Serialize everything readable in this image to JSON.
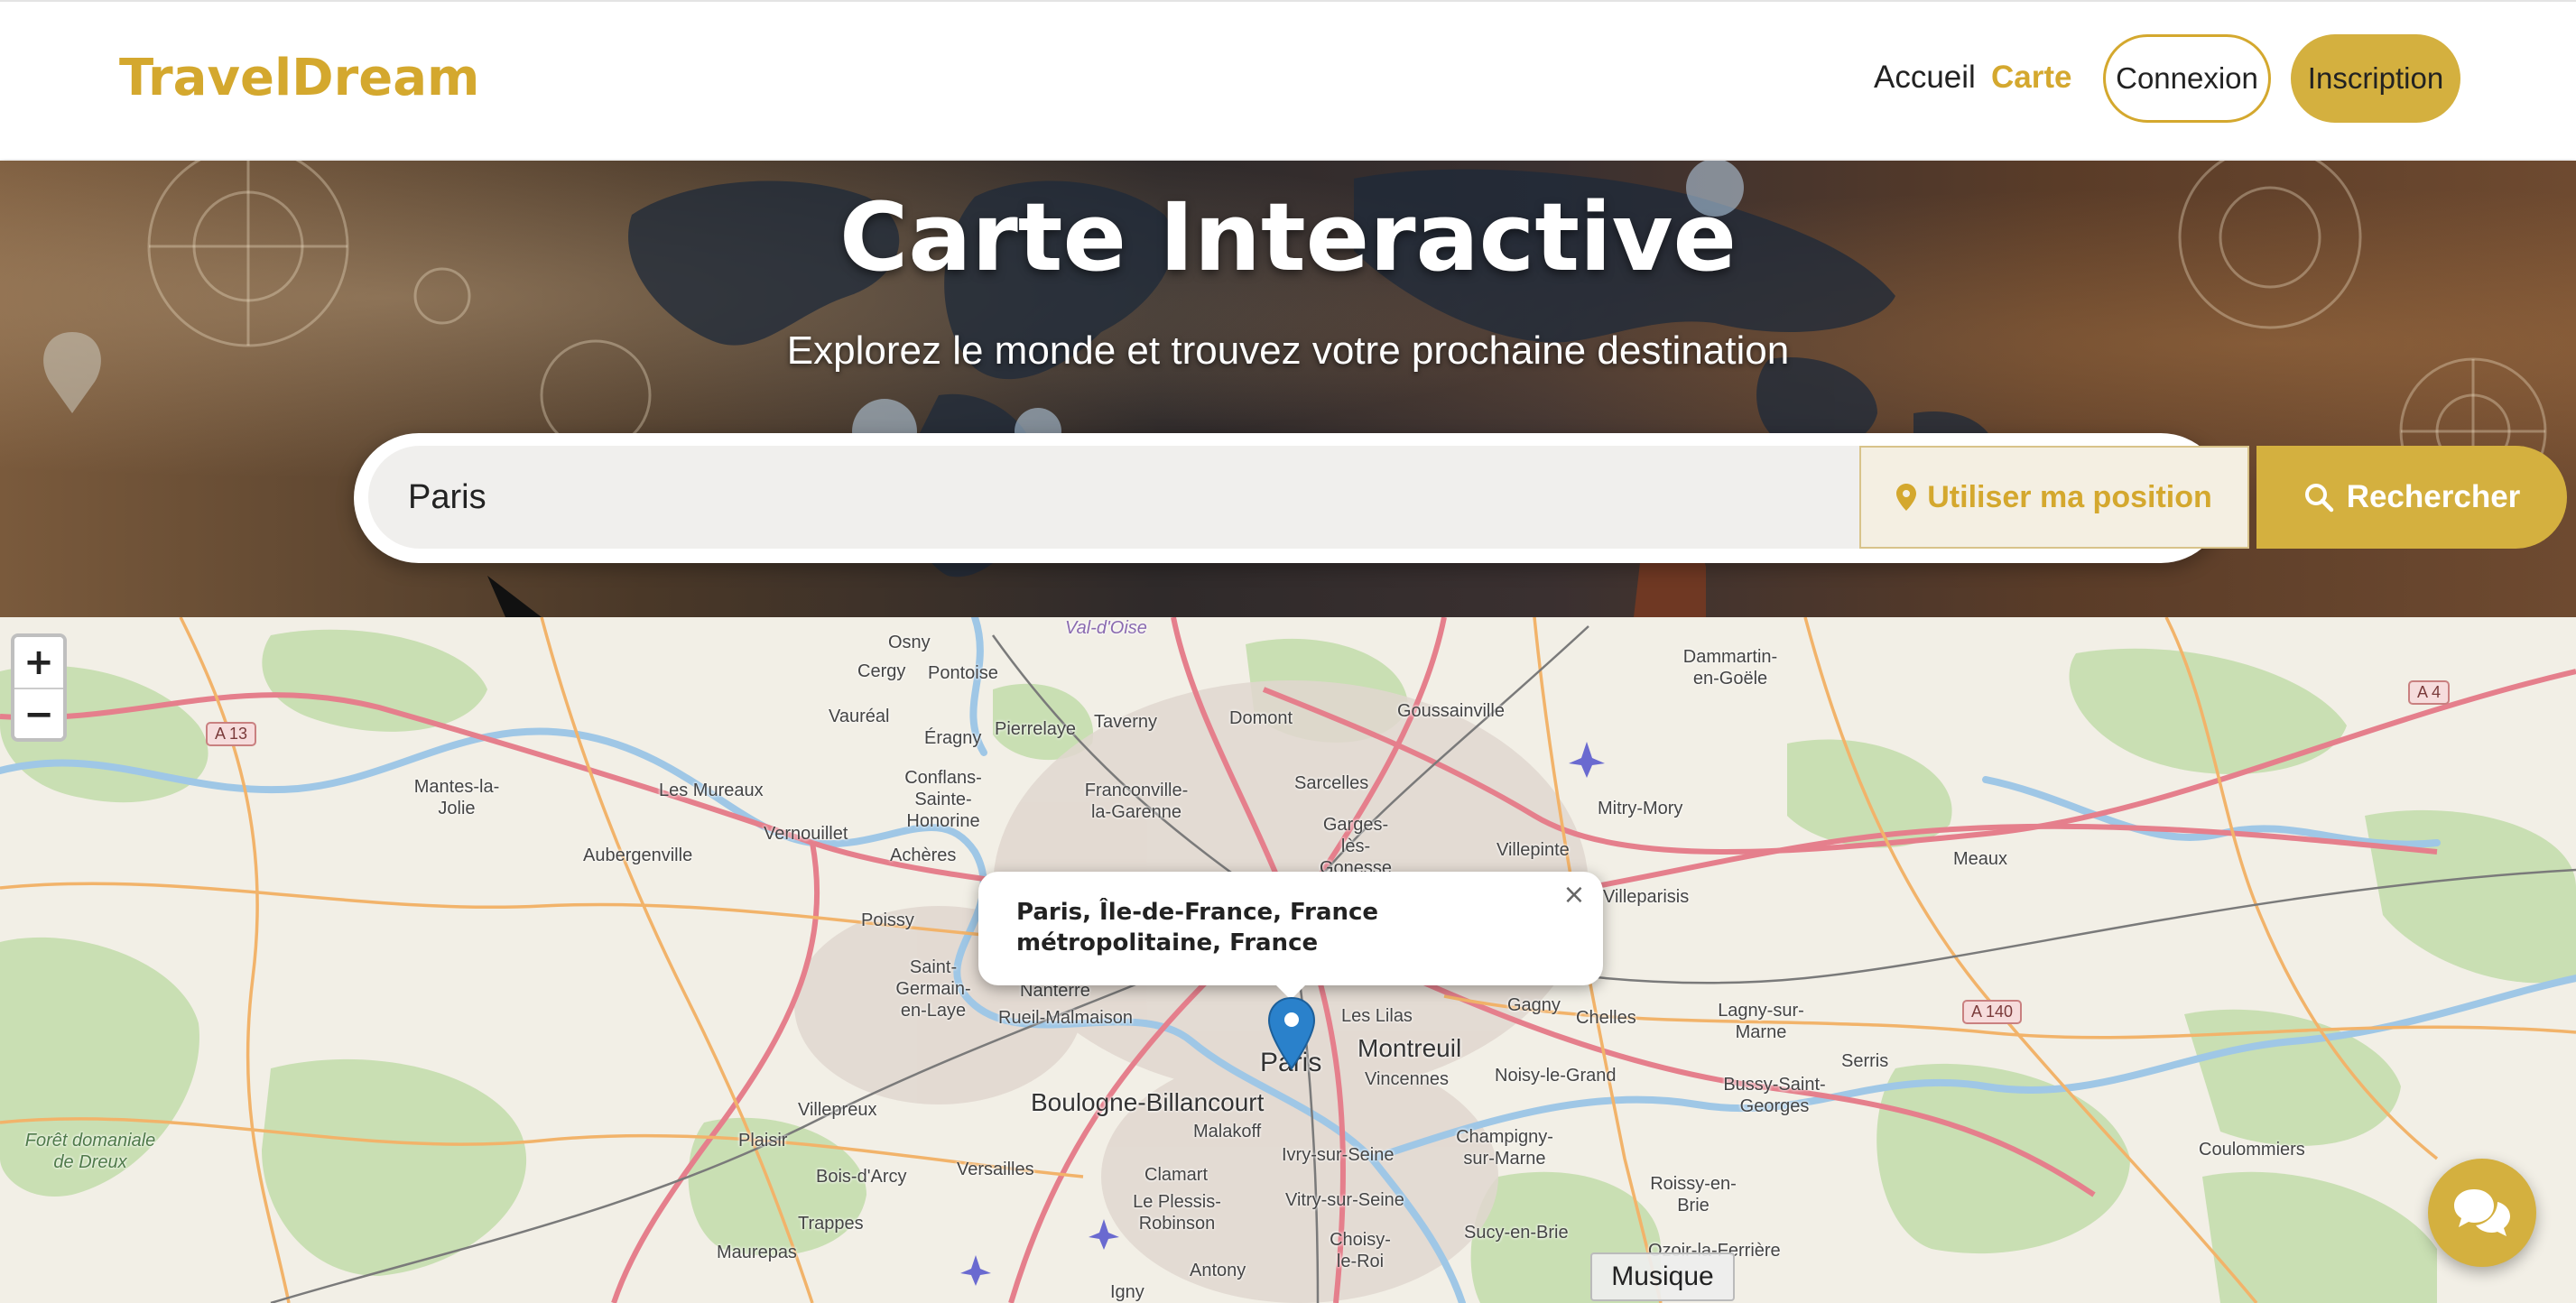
{
  "header": {
    "brand": "TravelDream",
    "nav": {
      "home": "Accueil",
      "map": "Carte"
    },
    "login_label": "Connexion",
    "signup_label": "Inscription"
  },
  "hero": {
    "title": "Carte Interactive",
    "subtitle": "Explorez le monde et trouvez votre prochaine destination",
    "search": {
      "value": "Paris",
      "locate_label": "Utiliser ma position",
      "submit_label": "Rechercher"
    }
  },
  "map": {
    "zoom_in": "+",
    "zoom_out": "−",
    "popup_text": "Paris, Île-de-France, France métropolitaine, France",
    "popup_close": "×",
    "music_label": "Musique",
    "labels": [
      "Osny",
      "Val-d'Oise",
      "Cergy",
      "Pontoise",
      "Vauréal",
      "Éragny",
      "Pierrelaye",
      "Taverny",
      "Domont",
      "Goussainville",
      "Dammartin-en-Goële",
      "Mantes-la-Jolie",
      "Les Mureaux",
      "Conflans-Sainte-Honorine",
      "Franconville-la-Garenne",
      "Sarcelles",
      "Garges-lès-Gonesse",
      "Mitry-Mory",
      "Villepinte",
      "Vernouillet",
      "Aubergenville",
      "Achères",
      "Poissy",
      "Villeparisis",
      "Meaux",
      "Saint-Germain-en-Laye",
      "Nanterre",
      "Rueil-Malmaison",
      "Les Lilas",
      "Montreuil",
      "Vincennes",
      "Gagny",
      "Chelles",
      "Lagny-sur-Marne",
      "Noisy-le-Grand",
      "Bussy-Saint-Georges",
      "Serris",
      "Boulogne-Billancourt",
      "Paris",
      "Villepreux",
      "Malakoff",
      "Champigny-sur-Marne",
      "Forêt domaniale de Dreux",
      "Plaisir",
      "Bois-d'Arcy",
      "Versailles",
      "Clamart",
      "Ivry-sur-Seine",
      "Vitry-sur-Seine",
      "Roissy-en-Brie",
      "Coulommiers",
      "Le Plessis-Robinson",
      "Trappes",
      "Maurepas",
      "Choisy-le-Roi",
      "Sucy-en-Brie",
      "Ozoir-la-Ferrière",
      "Antony",
      "Igny"
    ],
    "road_shields": [
      "A 13",
      "A 4",
      "A 140"
    ]
  },
  "colors": {
    "accent": "#d4a82e",
    "button_gold": "#d4b03f",
    "marker_blue": "#2a81cb"
  },
  "icons": {
    "locate": "map-pin-icon",
    "search": "magnifier-icon",
    "chat": "chat-bubbles-icon",
    "marker": "location-marker-icon"
  }
}
